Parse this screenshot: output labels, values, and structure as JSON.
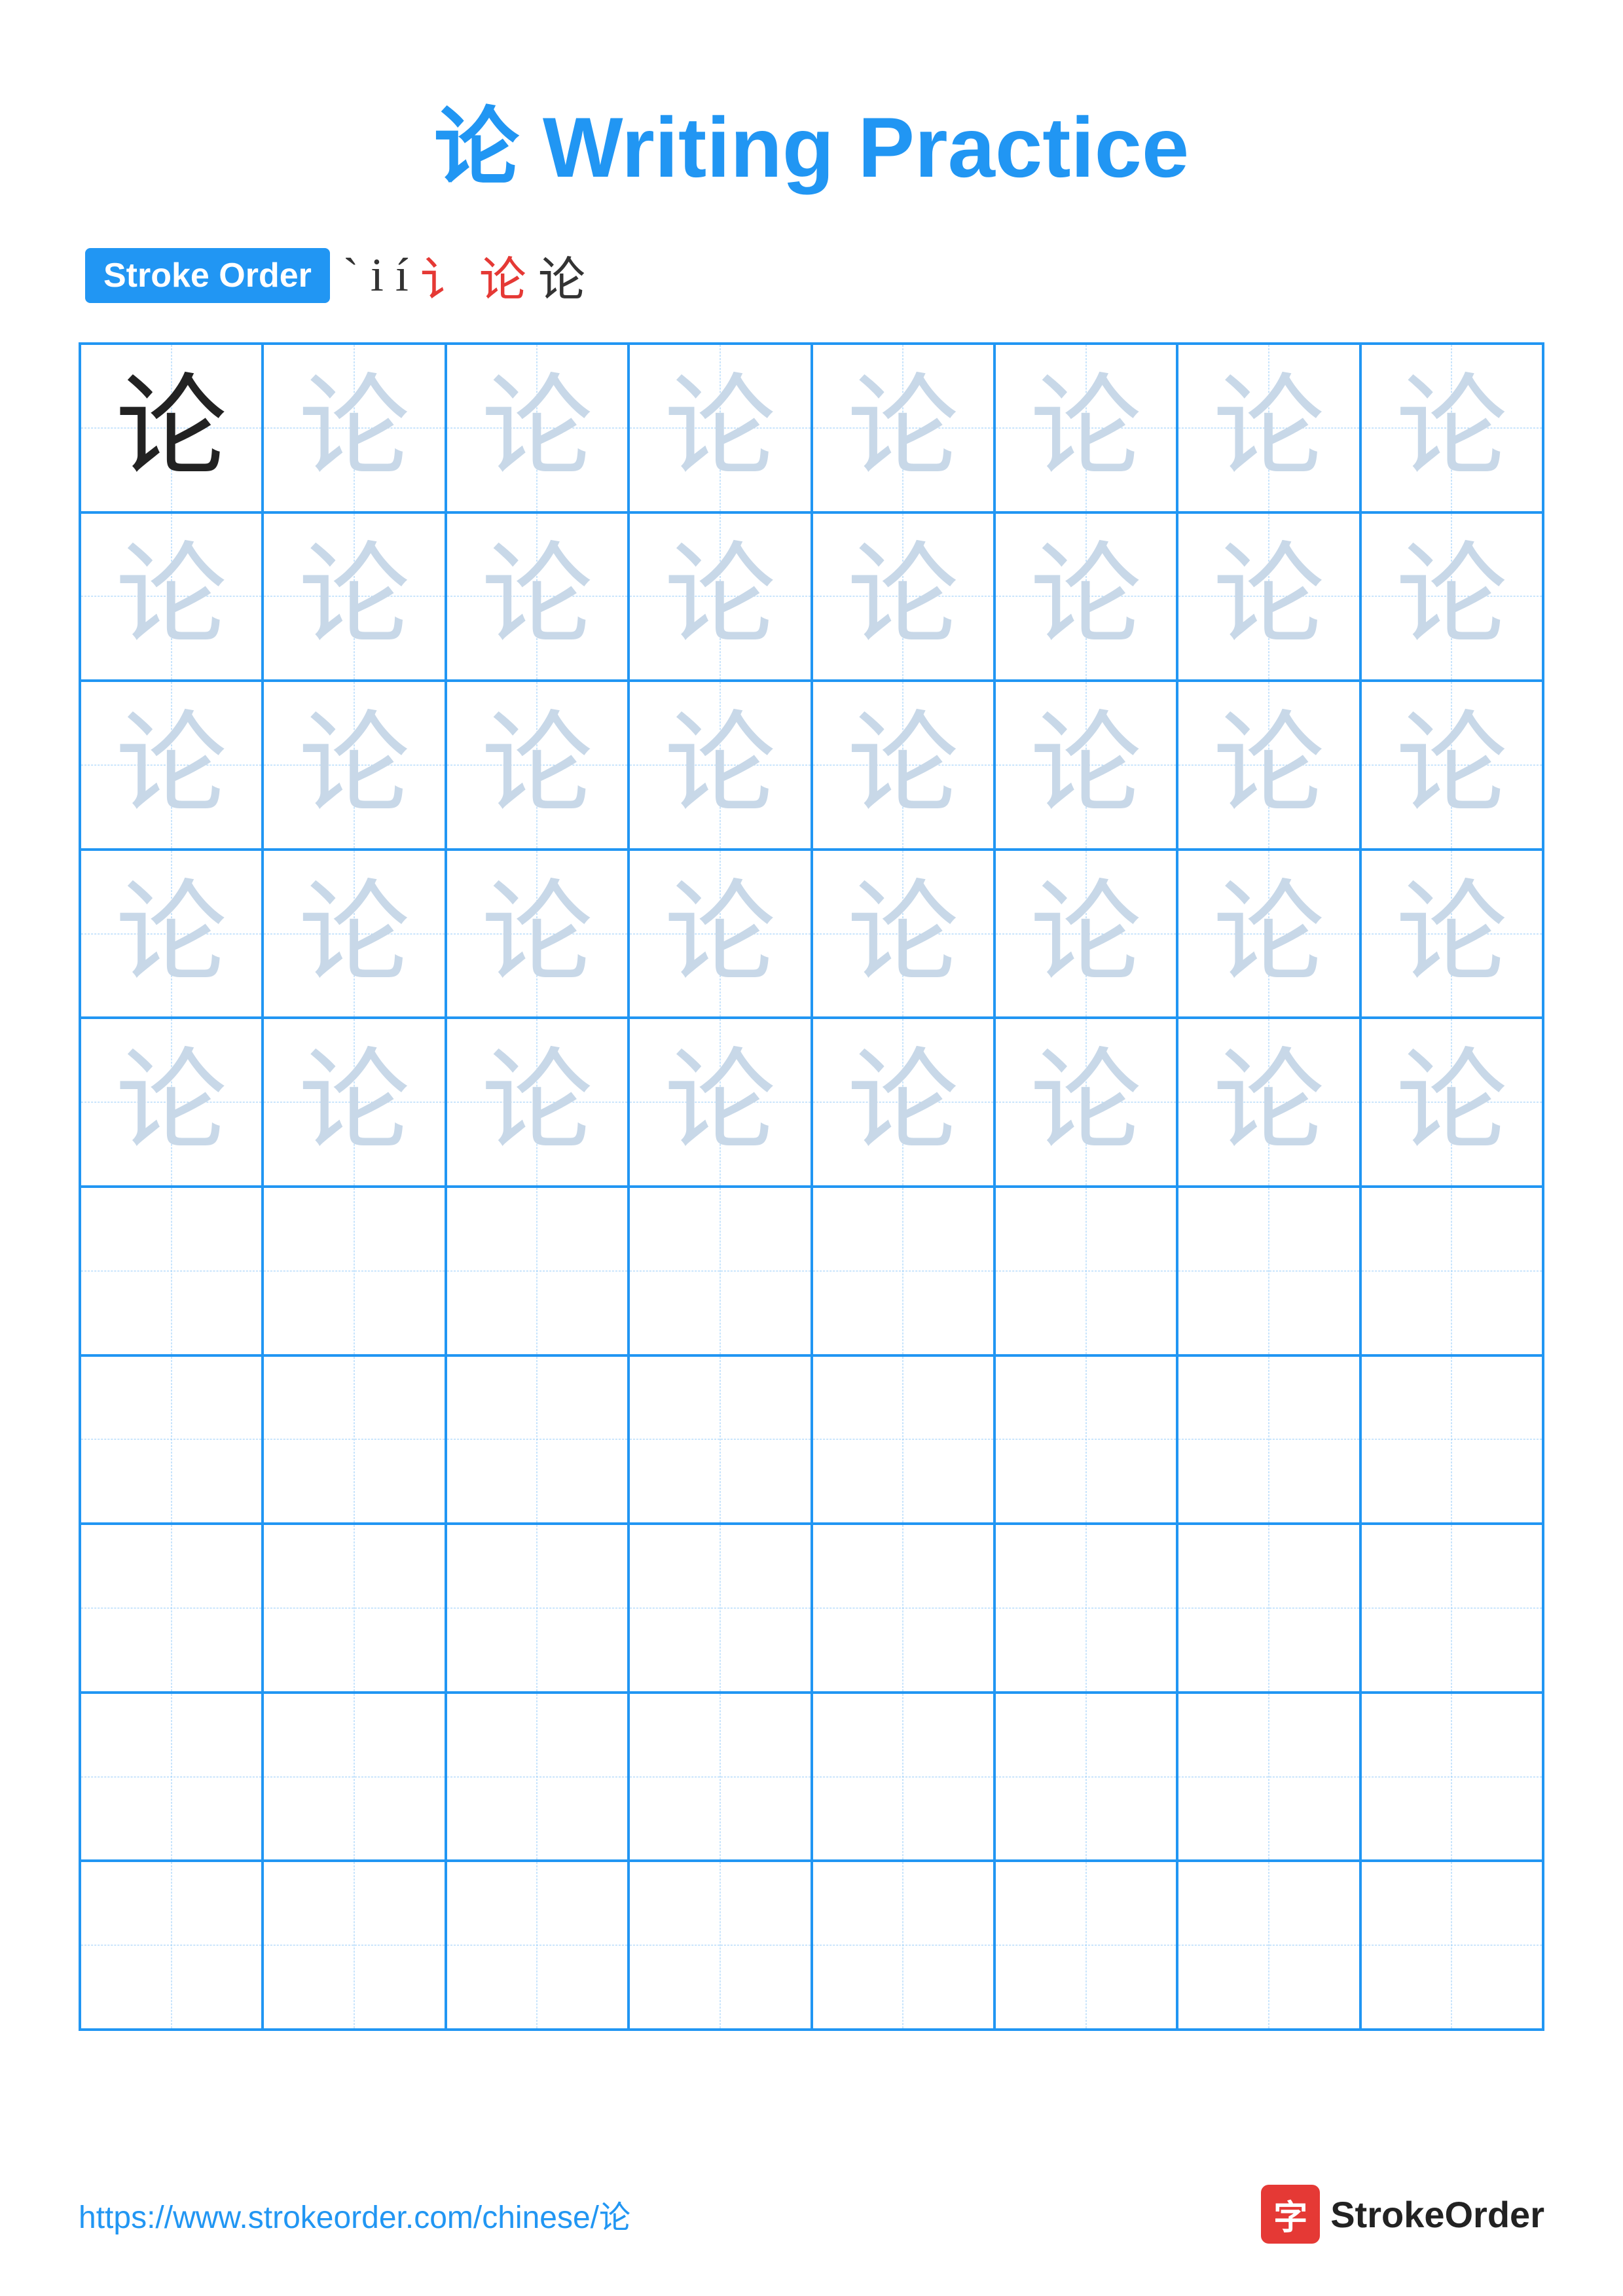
{
  "title": {
    "char": "论",
    "text": " Writing Practice",
    "full": "论 Writing Practice"
  },
  "stroke_order": {
    "badge_label": "Stroke Order",
    "strokes": [
      "`",
      "i",
      "i'",
      "i讠",
      "i论",
      "论"
    ]
  },
  "grid": {
    "cols": 8,
    "rows": 10,
    "char": "论",
    "filled_rows": 5,
    "first_cell_dark": true
  },
  "footer": {
    "url": "https://www.strokeorder.com/chinese/论",
    "logo_char": "字",
    "logo_name": "StrokeOrder"
  }
}
